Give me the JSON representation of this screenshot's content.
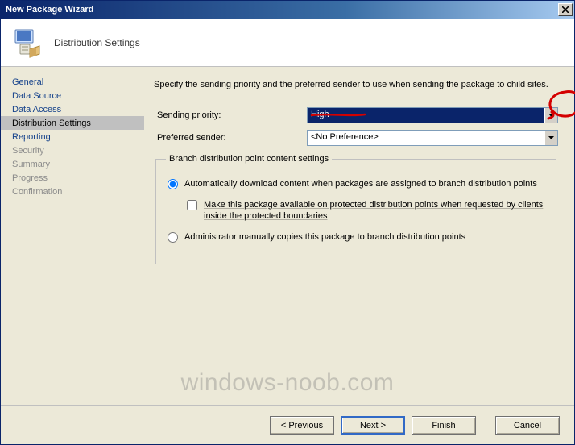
{
  "window": {
    "title": "New Package Wizard"
  },
  "header": {
    "page_title": "Distribution Settings"
  },
  "sidebar": {
    "items": [
      {
        "label": "General",
        "active": false
      },
      {
        "label": "Data Source",
        "active": false
      },
      {
        "label": "Data Access",
        "active": false
      },
      {
        "label": "Distribution Settings",
        "active": true
      },
      {
        "label": "Reporting",
        "active": false
      },
      {
        "label": "Security",
        "dim": true
      },
      {
        "label": "Summary",
        "dim": true
      },
      {
        "label": "Progress",
        "dim": true
      },
      {
        "label": "Confirmation",
        "dim": true
      }
    ]
  },
  "content": {
    "instruction": "Specify the sending priority and the preferred sender to use when sending the package to child sites.",
    "sending_priority_label": "Sending priority:",
    "sending_priority_value": "High",
    "preferred_sender_label": "Preferred sender:",
    "preferred_sender_value": "<No Preference>",
    "group": {
      "legend": "Branch distribution point content settings",
      "radio_auto": "Automatically download content when packages are assigned to branch distribution points",
      "check_protected": "Make this package available on protected distribution points when requested by clients inside the protected boundaries",
      "radio_manual": "Administrator manually copies this package to branch distribution points"
    }
  },
  "footer": {
    "previous": "< Previous",
    "next": "Next >",
    "finish": "Finish",
    "cancel": "Cancel"
  },
  "watermark": "windows-noob.com"
}
